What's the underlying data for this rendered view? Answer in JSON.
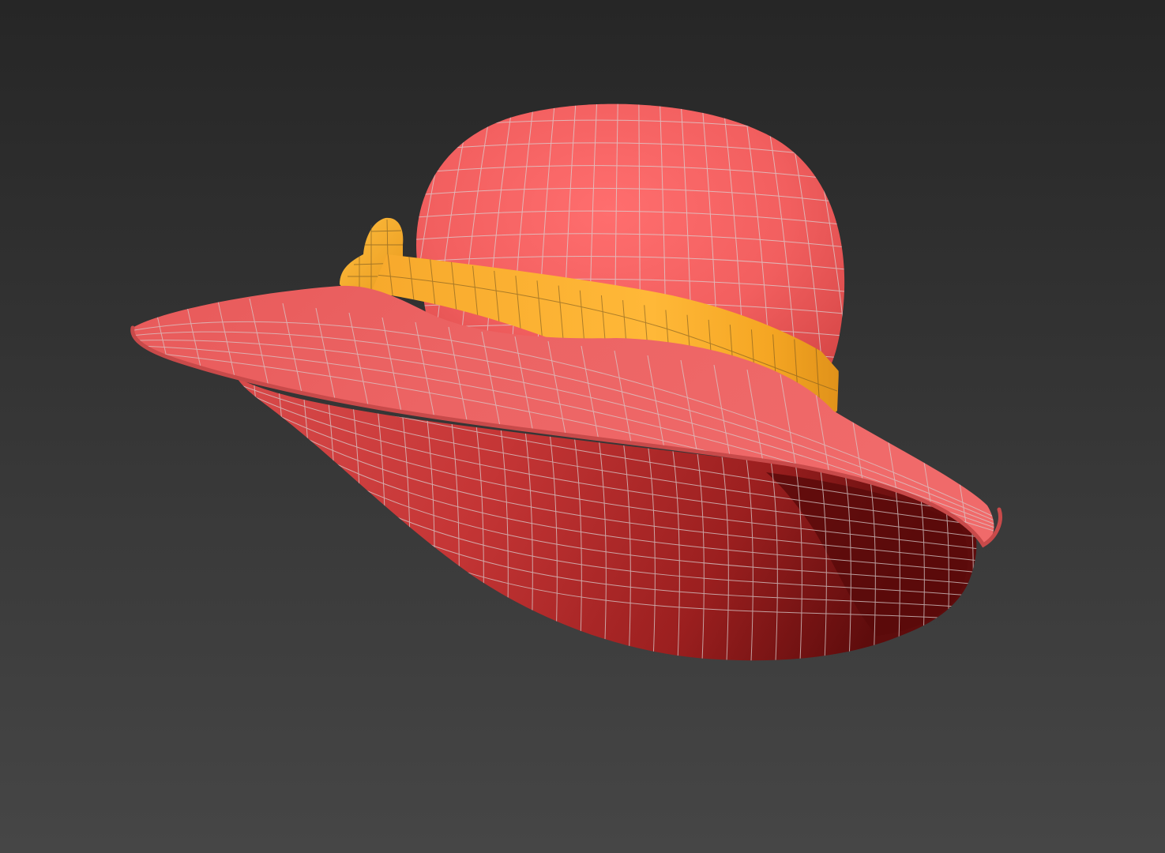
{
  "viewport": {
    "background_top": "#262626",
    "background_bottom": "#464646"
  },
  "model": {
    "subject": "sun-hat",
    "hat_color": "#f06262",
    "hat_shadow_color": "#8e1a1a",
    "band_color": "#f5a623",
    "band_highlight": "#ffbf3a",
    "wireframe_color": "#c9c9c9",
    "display_mode": "shaded-with-wireframe"
  }
}
